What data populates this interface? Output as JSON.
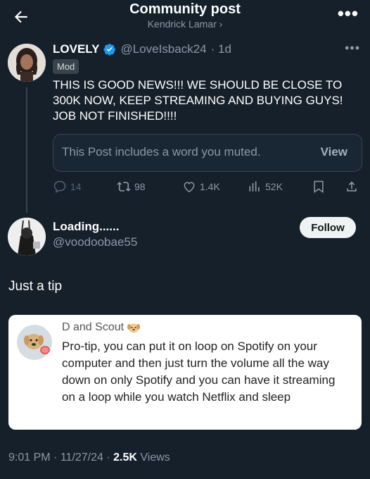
{
  "header": {
    "title": "Community post",
    "subtitle": "Kendrick Lamar ›"
  },
  "post": {
    "author_name": "LOVELY",
    "handle": "@LoveIsback24",
    "time": "· 1d",
    "badge": "Mod",
    "text": "THIS IS GOOD NEWS!!! WE SHOULD BE CLOSE TO 300K NOW, KEEP STREAMING AND BUYING GUYS! JOB NOT FINISHED!!!!",
    "muted_notice": "This Post includes a word you muted.",
    "view_label": "View",
    "stats": {
      "replies": "14",
      "reposts": "98",
      "likes": "1.4K",
      "views": "52K"
    }
  },
  "reply": {
    "author_name": "Loading......",
    "handle": "@voodoobae55",
    "follow_label": "Follow",
    "text": "Just a tip",
    "quote": {
      "author_name": "D and Scout",
      "text": "Pro-tip, you can put it on loop on Spotify on your computer and then just turn the volume all the way down on only Spotify and you can have it streaming on a loop while you watch Netflix and sleep"
    },
    "meta": {
      "time": "9:01 PM",
      "date": "11/27/24",
      "views_count": "2.5K",
      "views_label": "Views"
    }
  },
  "colors": {
    "background": "#15202b",
    "verified": "#1d9bf0",
    "muted_text": "#8b98a5"
  }
}
